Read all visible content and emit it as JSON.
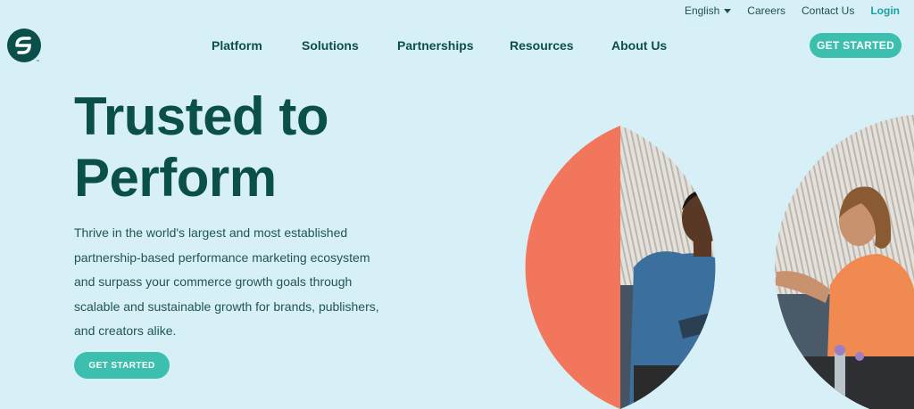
{
  "utility_nav": {
    "language": "English",
    "careers": "Careers",
    "contact": "Contact Us",
    "login": "Login"
  },
  "main_nav": {
    "items": [
      {
        "label": "Platform"
      },
      {
        "label": "Solutions"
      },
      {
        "label": "Partnerships"
      },
      {
        "label": "Resources"
      },
      {
        "label": "About Us"
      }
    ],
    "cta": "GET STARTED"
  },
  "hero": {
    "title_line1": "Trusted to",
    "title_line2": "Perform",
    "body": "Thrive in the world's largest and most established partnership-based performance marketing ecosystem and surpass your commerce growth goals through scalable and sustainable growth for brands, publishers, and creators alike.",
    "cta": "GET STARTED"
  },
  "colors": {
    "background": "#d7f0f8",
    "brand_dark_green": "#0b4f4a",
    "accent_teal": "#3dbfb0",
    "login_teal": "#1aa3a0",
    "coral_shape": "#f2765c"
  }
}
